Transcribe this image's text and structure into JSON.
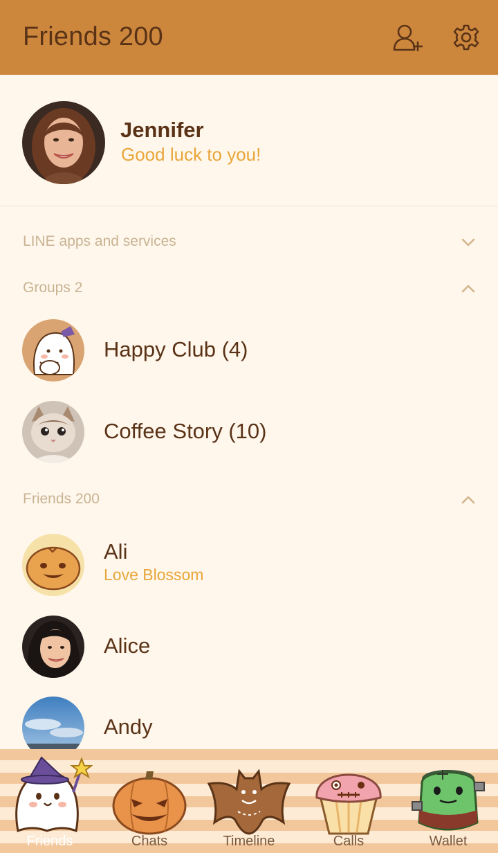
{
  "header": {
    "title": "Friends 200",
    "add_friend_icon": "add-friend-icon",
    "settings_icon": "gear-icon",
    "background_color": "#cd873d"
  },
  "profile": {
    "name": "Jennifer",
    "status": "Good luck to you!"
  },
  "sections": {
    "line_apps": {
      "label": "LINE apps and services",
      "expanded": false
    },
    "groups": {
      "label": "Groups 2",
      "expanded": true
    },
    "friends": {
      "label": "Friends 200",
      "expanded": true
    }
  },
  "groups": [
    {
      "name": "Happy Club (4)"
    },
    {
      "name": "Coffee Story (10)"
    }
  ],
  "friends": [
    {
      "name": "Ali",
      "status": "Love Blossom"
    },
    {
      "name": "Alice",
      "status": ""
    },
    {
      "name": "Andy",
      "status": ""
    }
  ],
  "tabs": [
    {
      "label": "Friends",
      "icon": "ghost-icon",
      "active": true
    },
    {
      "label": "Chats",
      "icon": "pumpkin-icon",
      "active": false
    },
    {
      "label": "Timeline",
      "icon": "bat-cookie-icon",
      "active": false
    },
    {
      "label": "Calls",
      "icon": "cupcake-icon",
      "active": false
    },
    {
      "label": "Wallet",
      "icon": "frankenstein-icon",
      "active": false
    }
  ],
  "colors": {
    "primary_text": "#5a3317",
    "status_text": "#e8a63a",
    "section_text": "#c9b393",
    "background": "#fff7ec"
  }
}
